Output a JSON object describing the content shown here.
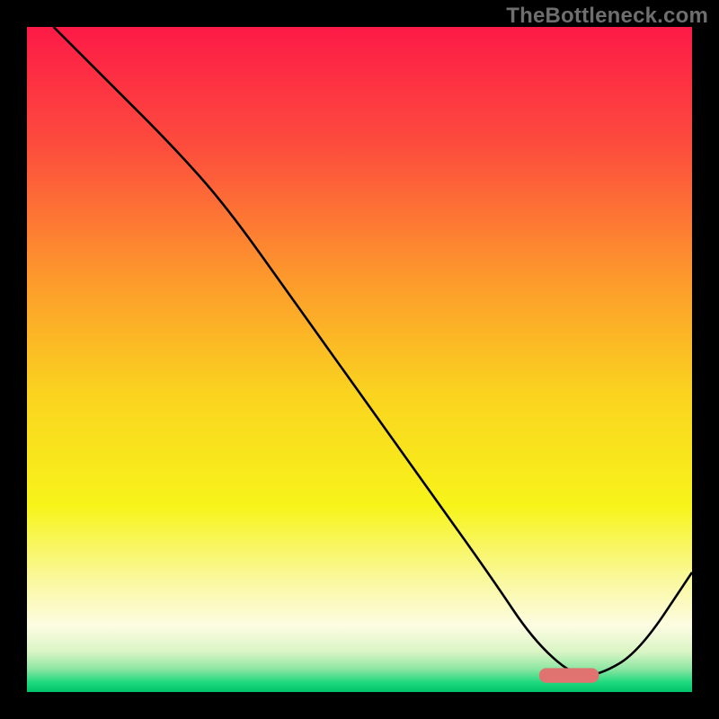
{
  "watermark": "TheBottleneck.com",
  "colors": {
    "black": "#000000",
    "curve": "#000000",
    "marker_fill": "#e0736f",
    "gradient_stops": [
      {
        "offset": 0.0,
        "color": "#fd1a47"
      },
      {
        "offset": 0.18,
        "color": "#fd4d3d"
      },
      {
        "offset": 0.38,
        "color": "#fd9a2c"
      },
      {
        "offset": 0.55,
        "color": "#fad31f"
      },
      {
        "offset": 0.72,
        "color": "#f7f41a"
      },
      {
        "offset": 0.83,
        "color": "#faf89c"
      },
      {
        "offset": 0.9,
        "color": "#fdfce2"
      },
      {
        "offset": 0.94,
        "color": "#d9f5c4"
      },
      {
        "offset": 0.965,
        "color": "#8ee6a3"
      },
      {
        "offset": 0.985,
        "color": "#21d97f"
      },
      {
        "offset": 1.0,
        "color": "#00c46a"
      }
    ]
  },
  "chart_data": {
    "type": "line",
    "title": "",
    "xlabel": "",
    "ylabel": "",
    "xlim": [
      0,
      100
    ],
    "ylim": [
      0,
      100
    ],
    "grid": false,
    "legend": false,
    "series": [
      {
        "name": "bottleneck-curve",
        "x": [
          4,
          12,
          22,
          30,
          40,
          50,
          60,
          70,
          76,
          82,
          86,
          92,
          100
        ],
        "y": [
          100,
          92,
          82,
          73,
          59,
          45,
          31,
          17,
          8,
          2.5,
          2.5,
          6,
          18
        ]
      }
    ],
    "annotations": [
      {
        "name": "optimal-marker",
        "shape": "rounded-bar",
        "x_start": 77,
        "x_end": 86,
        "y": 2.5,
        "height": 2.2
      }
    ]
  }
}
